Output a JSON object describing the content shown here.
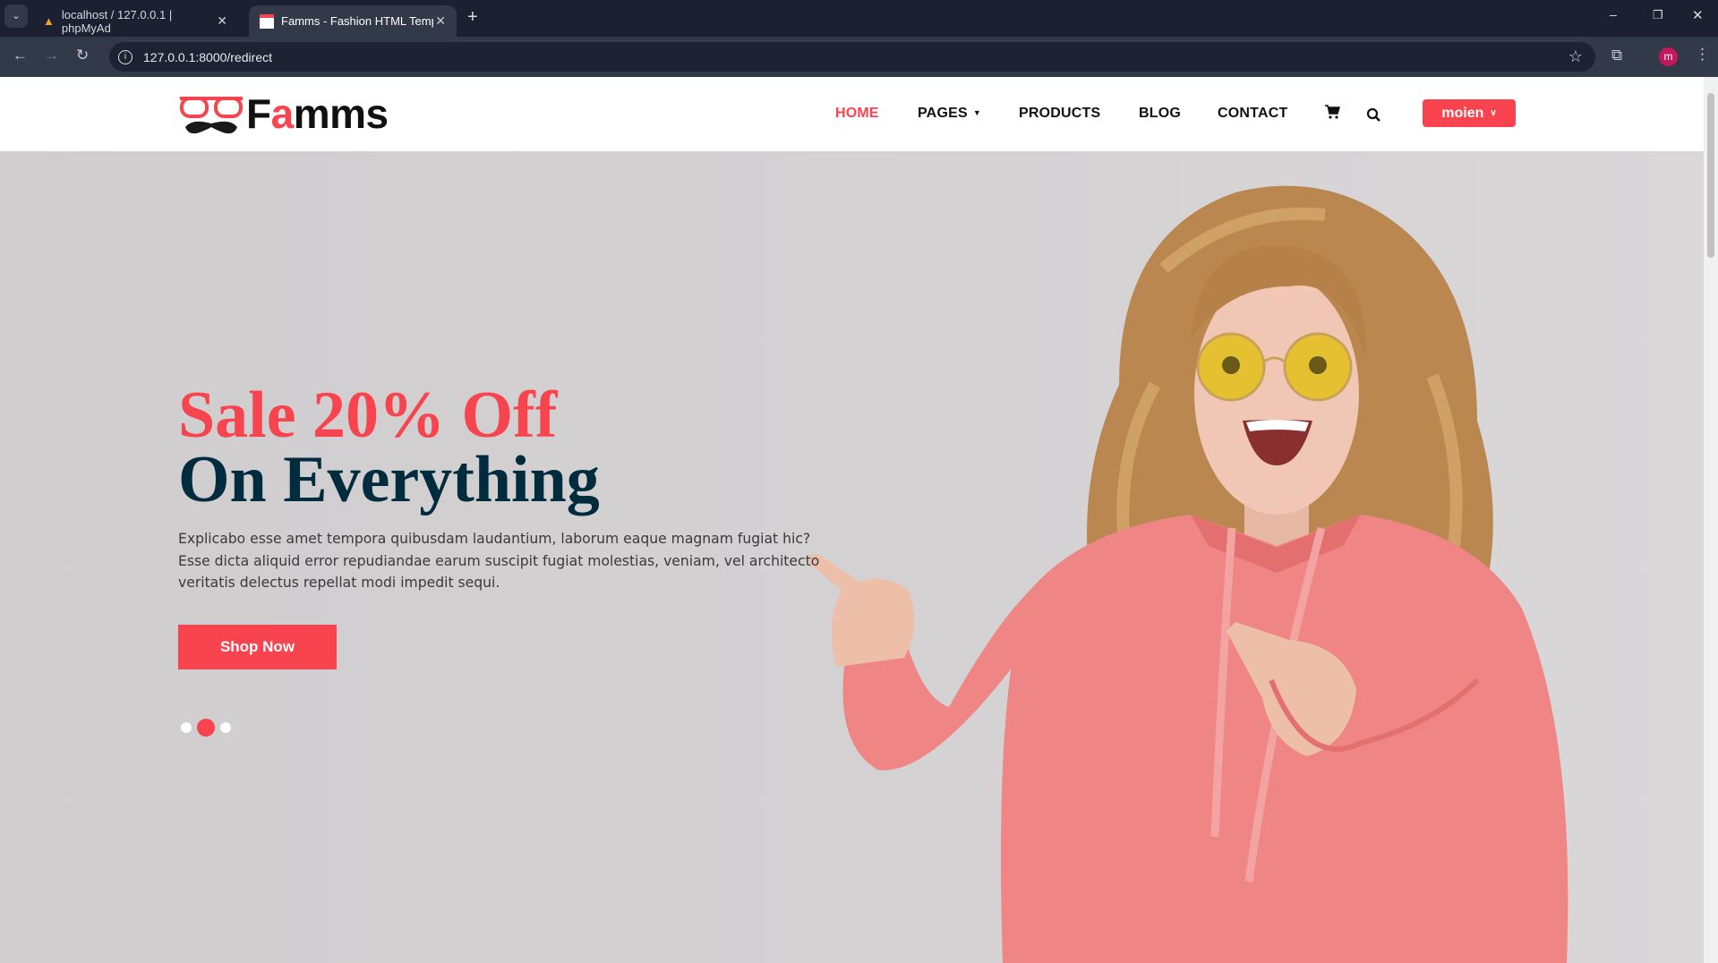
{
  "browser": {
    "tabs": [
      {
        "title": "localhost / 127.0.0.1 | phpMyAd",
        "icon": "phpmyadmin-icon",
        "active": false
      },
      {
        "title": "Famms - Fashion HTML Templat",
        "icon": "famms-favicon",
        "active": true
      }
    ],
    "url": "127.0.0.1:8000/redirect",
    "profile_initial": "m"
  },
  "site": {
    "logo": {
      "prefix": "F",
      "accent": "a",
      "suffix": "mms"
    },
    "nav": [
      {
        "label": "HOME",
        "active": true
      },
      {
        "label": "PAGES",
        "dropdown": true
      },
      {
        "label": "PRODUCTS"
      },
      {
        "label": "BLOG"
      },
      {
        "label": "CONTACT"
      }
    ],
    "user_button": "moien",
    "colors": {
      "accent": "#f7444e",
      "dark": "#002c3e"
    }
  },
  "hero": {
    "headline_1": "Sale 20% Off",
    "headline_2": "On Everything",
    "description": "Explicabo esse amet tempora quibusdam laudantium, laborum eaque magnam fugiat hic? Esse dicta aliquid error repudiandae earum suscipit fugiat molestias, veniam, vel architecto veritatis delectus repellat modi impedit sequi.",
    "cta": "Shop Now",
    "slides": 3,
    "active_slide": 2
  }
}
